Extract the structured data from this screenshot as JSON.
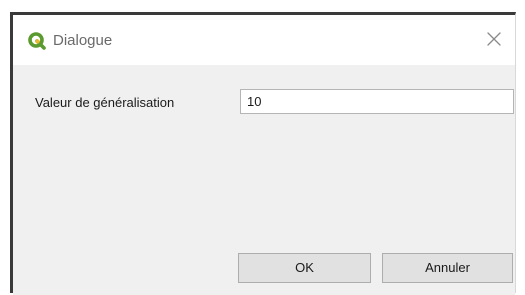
{
  "window": {
    "title": "Dialogue",
    "close_icon": "close-icon",
    "app_icon": "qgis-logo-icon"
  },
  "form": {
    "label": "Valeur de généralisation",
    "value": "10"
  },
  "buttons": {
    "ok_label": "OK",
    "cancel_label": "Annuler"
  },
  "colors": {
    "qgis_green": "#5a9a2e",
    "qgis_yellow": "#e8b92a"
  }
}
